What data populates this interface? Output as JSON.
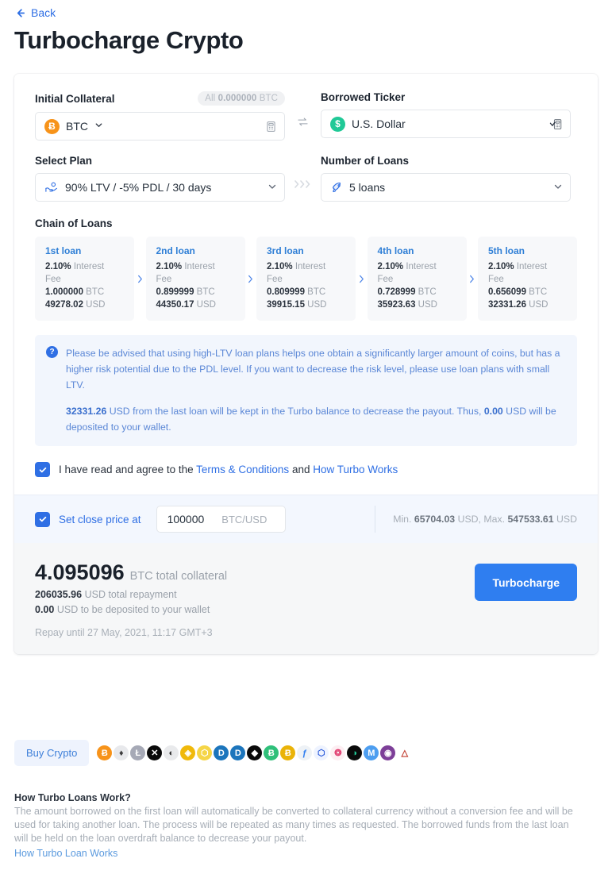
{
  "header": {
    "back_label": "Back",
    "back_icon": "arrow-left-icon",
    "title": "Turbocharge Crypto"
  },
  "form": {
    "initial_collateral": {
      "label": "Initial Collateral",
      "all_prefix": "All",
      "all_amount": "0.000000",
      "all_unit": "BTC",
      "coin_symbol": "Ƀ",
      "value": "BTC",
      "caret": "⌄",
      "right_icon": "calculator-icon"
    },
    "swap_icon": "swap-icon",
    "borrowed_ticker": {
      "label": "Borrowed Ticker",
      "coin_symbol": "$",
      "value": "U.S. Dollar",
      "right_icon": "calculator-check-icon"
    },
    "select_plan": {
      "label": "Select Plan",
      "icon": "hand-coin-icon",
      "value": "90% LTV / -5% PDL / 30 days",
      "caret": "⌄"
    },
    "arrows_icon": "chevrons-right-icon",
    "number_of_loans": {
      "label": "Number of Loans",
      "icon": "rocket-icon",
      "value": "5 loans",
      "caret": "⌄"
    }
  },
  "chain": {
    "title": "Chain of Loans",
    "separator_icon": "chevron-right-icon",
    "loans": [
      {
        "title": "1st loan",
        "rate": "2.10%",
        "rate_label": "Interest",
        "fee_label": "Fee",
        "btc": "1.000000",
        "btc_unit": "BTC",
        "usd": "49278.02",
        "usd_unit": "USD"
      },
      {
        "title": "2nd loan",
        "rate": "2.10%",
        "rate_label": "Interest",
        "fee_label": "Fee",
        "btc": "0.899999",
        "btc_unit": "BTC",
        "usd": "44350.17",
        "usd_unit": "USD"
      },
      {
        "title": "3rd loan",
        "rate": "2.10%",
        "rate_label": "Interest",
        "fee_label": "Fee",
        "btc": "0.809999",
        "btc_unit": "BTC",
        "usd": "39915.15",
        "usd_unit": "USD"
      },
      {
        "title": "4th loan",
        "rate": "2.10%",
        "rate_label": "Interest",
        "fee_label": "Fee",
        "btc": "0.728999",
        "btc_unit": "BTC",
        "usd": "35923.63",
        "usd_unit": "USD"
      },
      {
        "title": "5th loan",
        "rate": "2.10%",
        "rate_label": "Interest",
        "fee_label": "Fee",
        "btc": "0.656099",
        "btc_unit": "BTC",
        "usd": "32331.26",
        "usd_unit": "USD"
      }
    ]
  },
  "notice": {
    "icon": "question-mark-icon",
    "paragraph1": "Please be advised that using high-LTV loan plans helps one obtain a significantly larger amount of coins, but has a higher risk potential due to the PDL level. If you want to decrease the risk level, please use loan plans with small LTV.",
    "p2_amount": "32331.26",
    "p2_mid": " USD from the last loan will be kept in the Turbo balance to decrease the payout. Thus, ",
    "p2_payout": "0.00",
    "p2_tail": " USD will be deposited to your wallet."
  },
  "agreement": {
    "checked": true,
    "check_icon": "check-icon",
    "text_before": "I have read and agree to the ",
    "link1": "Terms & Conditions",
    "text_mid": " and ",
    "link2": "How Turbo Works"
  },
  "close_price": {
    "checked": true,
    "check_icon": "check-icon",
    "label": "Set close price at",
    "value": "100000",
    "placeholder": "100000",
    "unit": "BTC/USD",
    "min_label": "Min.",
    "min_value": "65704.03",
    "min_unit": "USD,",
    "max_label": "Max.",
    "max_value": "547533.61",
    "max_unit": "USD"
  },
  "summary": {
    "total_collateral_value": "4.095096",
    "total_collateral_label": "BTC total collateral",
    "repayment_value": "206035.96",
    "repayment_label": "USD total repayment",
    "deposit_value": "0.00",
    "deposit_label": "USD to be deposited to your wallet",
    "repay_until": "Repay until 27 May, 2021, 11:17 GMT+3",
    "button_label": "Turbocharge"
  },
  "buy_crypto": {
    "button_label": "Buy Crypto",
    "coins": [
      {
        "name": "bitcoin-icon",
        "glyph": "Ƀ",
        "bg": "#f7931a",
        "fg": "#ffffff"
      },
      {
        "name": "ethereum-icon",
        "glyph": "♦",
        "bg": "#e8e9ec",
        "fg": "#3c3c3d"
      },
      {
        "name": "litecoin-icon",
        "glyph": "Ł",
        "bg": "#a6a9b6",
        "fg": "#ffffff"
      },
      {
        "name": "ripple-icon",
        "glyph": "✕",
        "bg": "#0a0a0a",
        "fg": "#ffffff"
      },
      {
        "name": "stellar-icon",
        "glyph": "◐",
        "bg": "#e9eaec",
        "fg": "#2b2b2b"
      },
      {
        "name": "binance-coin-icon",
        "glyph": "◈",
        "bg": "#f0b90b",
        "fg": "#ffffff"
      },
      {
        "name": "nem-icon",
        "glyph": "⬡",
        "bg": "#f5d547",
        "fg": "#ffffff"
      },
      {
        "name": "dash-icon",
        "glyph": "D",
        "bg": "#1c75bc",
        "fg": "#ffffff"
      },
      {
        "name": "dash-duo-icon",
        "glyph": "D",
        "bg": "#1c75bc",
        "fg": "#ffffff"
      },
      {
        "name": "eos-icon",
        "glyph": "◆",
        "bg": "#0a0a0a",
        "fg": "#ffffff"
      },
      {
        "name": "bitcoin-cash-icon",
        "glyph": "Ƀ",
        "bg": "#2fc07a",
        "fg": "#ffffff"
      },
      {
        "name": "bitcoin-sv-icon",
        "glyph": "Ƀ",
        "bg": "#eab308",
        "fg": "#ffffff"
      },
      {
        "name": "huobi-token-icon",
        "glyph": "ƒ",
        "bg": "#eef2f6",
        "fg": "#2f7ef0"
      },
      {
        "name": "chainlink-icon",
        "glyph": "⬡",
        "bg": "#eef3ff",
        "fg": "#2a5ada"
      },
      {
        "name": "kyber-icon",
        "glyph": "❂",
        "bg": "#fdeef2",
        "fg": "#e0386c"
      },
      {
        "name": "siacoin-icon",
        "glyph": "◑",
        "bg": "#0a0a0a",
        "fg": "#20c997"
      },
      {
        "name": "monero-icon",
        "glyph": "M",
        "bg": "#4d9ef0",
        "fg": "#ffffff"
      },
      {
        "name": "maker-icon",
        "glyph": "◉",
        "bg": "#7d3f98",
        "fg": "#ffffff"
      },
      {
        "name": "bat-icon",
        "glyph": "△",
        "bg": "#ffffff",
        "fg": "#c0392b"
      }
    ]
  },
  "footer": {
    "title": "How Turbo Loans Work?",
    "body": "The amount borrowed on the first loan will automatically be converted to collateral currency without a conversion fee and will be used for taking another loan. The process will be repeated as many times as requested. The borrowed funds from the last loan will be held on the loan overdraft balance to decrease your payout.",
    "link": "How Turbo Loan Works"
  }
}
